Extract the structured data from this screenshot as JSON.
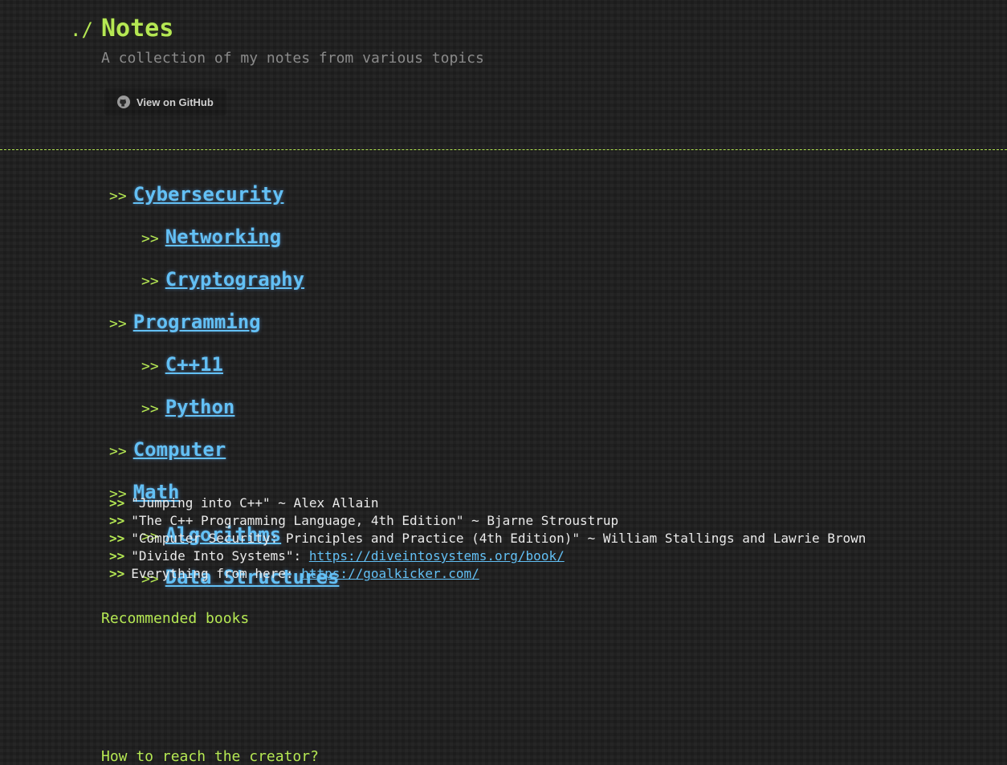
{
  "header": {
    "prompt": "./",
    "title": "Notes",
    "subtitle": "A collection of my notes from various topics",
    "github_button": "View on GitHub",
    "github_icon": "github-icon"
  },
  "nav": [
    {
      "arrow": ">>",
      "label": "Cybersecurity",
      "level": 0
    },
    {
      "arrow": ">>",
      "label": "Networking",
      "level": 1
    },
    {
      "arrow": ">>",
      "label": "Cryptography",
      "level": 1
    },
    {
      "arrow": ">>",
      "label": "Programming",
      "level": 0
    },
    {
      "arrow": ">>",
      "label": "C++11",
      "level": 1
    },
    {
      "arrow": ">>",
      "label": "Python",
      "level": 1
    },
    {
      "arrow": ">>",
      "label": "Computer",
      "level": 0
    },
    {
      "arrow": ">>",
      "label": "Math",
      "level": 0
    },
    {
      "arrow": ">>",
      "label": "Algorithms",
      "level": 1
    },
    {
      "arrow": ">>",
      "label": "Data Structures",
      "level": 1
    }
  ],
  "books": {
    "heading": "Recommended books",
    "items": [
      {
        "arrow": ">>",
        "text": "\"Jumping into C++\" ~ Alex Allain",
        "link": ""
      },
      {
        "arrow": ">>",
        "text": "\"The C++ Programming Language, 4th Edition\" ~ Bjarne Stroustrup",
        "link": ""
      },
      {
        "arrow": ">>",
        "text": "\"Computer Security: Principles and Practice (4th Edition)\" ~ William Stallings and Lawrie Brown",
        "link": ""
      },
      {
        "arrow": ">>",
        "text": "\"Divide Into Systems\": ",
        "link": "https://diveintosystems.org/book/"
      },
      {
        "arrow": ">>",
        "text": "Everything from here: ",
        "link": "https://goalkicker.com/"
      }
    ]
  },
  "contact": {
    "heading": "How to reach the creator?"
  },
  "colors": {
    "accent": "#b5e853",
    "link": "#63c0f5",
    "background": "#1e1e1e",
    "muted": "#8a8a8a"
  }
}
